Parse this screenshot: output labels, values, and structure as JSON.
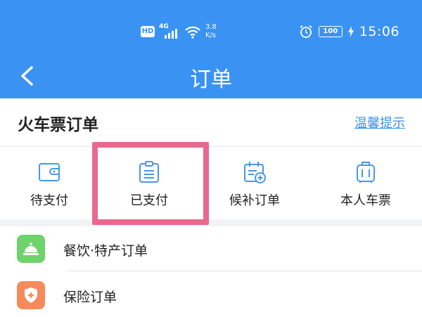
{
  "status_bar": {
    "hd": "HD",
    "network": "4G",
    "speed_value": "3.8",
    "speed_unit": "K/s",
    "battery": "100",
    "time": "15:06",
    "icons": [
      "signal-icon",
      "wifi-icon",
      "alarm-icon",
      "battery-icon",
      "charging-icon"
    ]
  },
  "header": {
    "title": "订单",
    "back_icon": "chevron-left-icon"
  },
  "train_orders": {
    "title": "火车票订单",
    "tips_link": "温馨提示",
    "tabs": [
      {
        "label": "待支付",
        "icon": "wallet-icon"
      },
      {
        "label": "已支付",
        "icon": "clipboard-icon",
        "highlighted": true
      },
      {
        "label": "候补订单",
        "icon": "calendar-add-icon"
      },
      {
        "label": "本人车票",
        "icon": "suitcase-icon"
      }
    ]
  },
  "list": {
    "items": [
      {
        "label": "餐饮·特产订单",
        "icon": "service-bell-icon",
        "color": "#6dd36a"
      },
      {
        "label": "保险订单",
        "icon": "shield-plus-icon",
        "color": "#f58a5c"
      }
    ]
  },
  "colors": {
    "header_blue": "#3a93f2",
    "highlight": "#e9688f",
    "icon_blue": "#4a96e8"
  }
}
